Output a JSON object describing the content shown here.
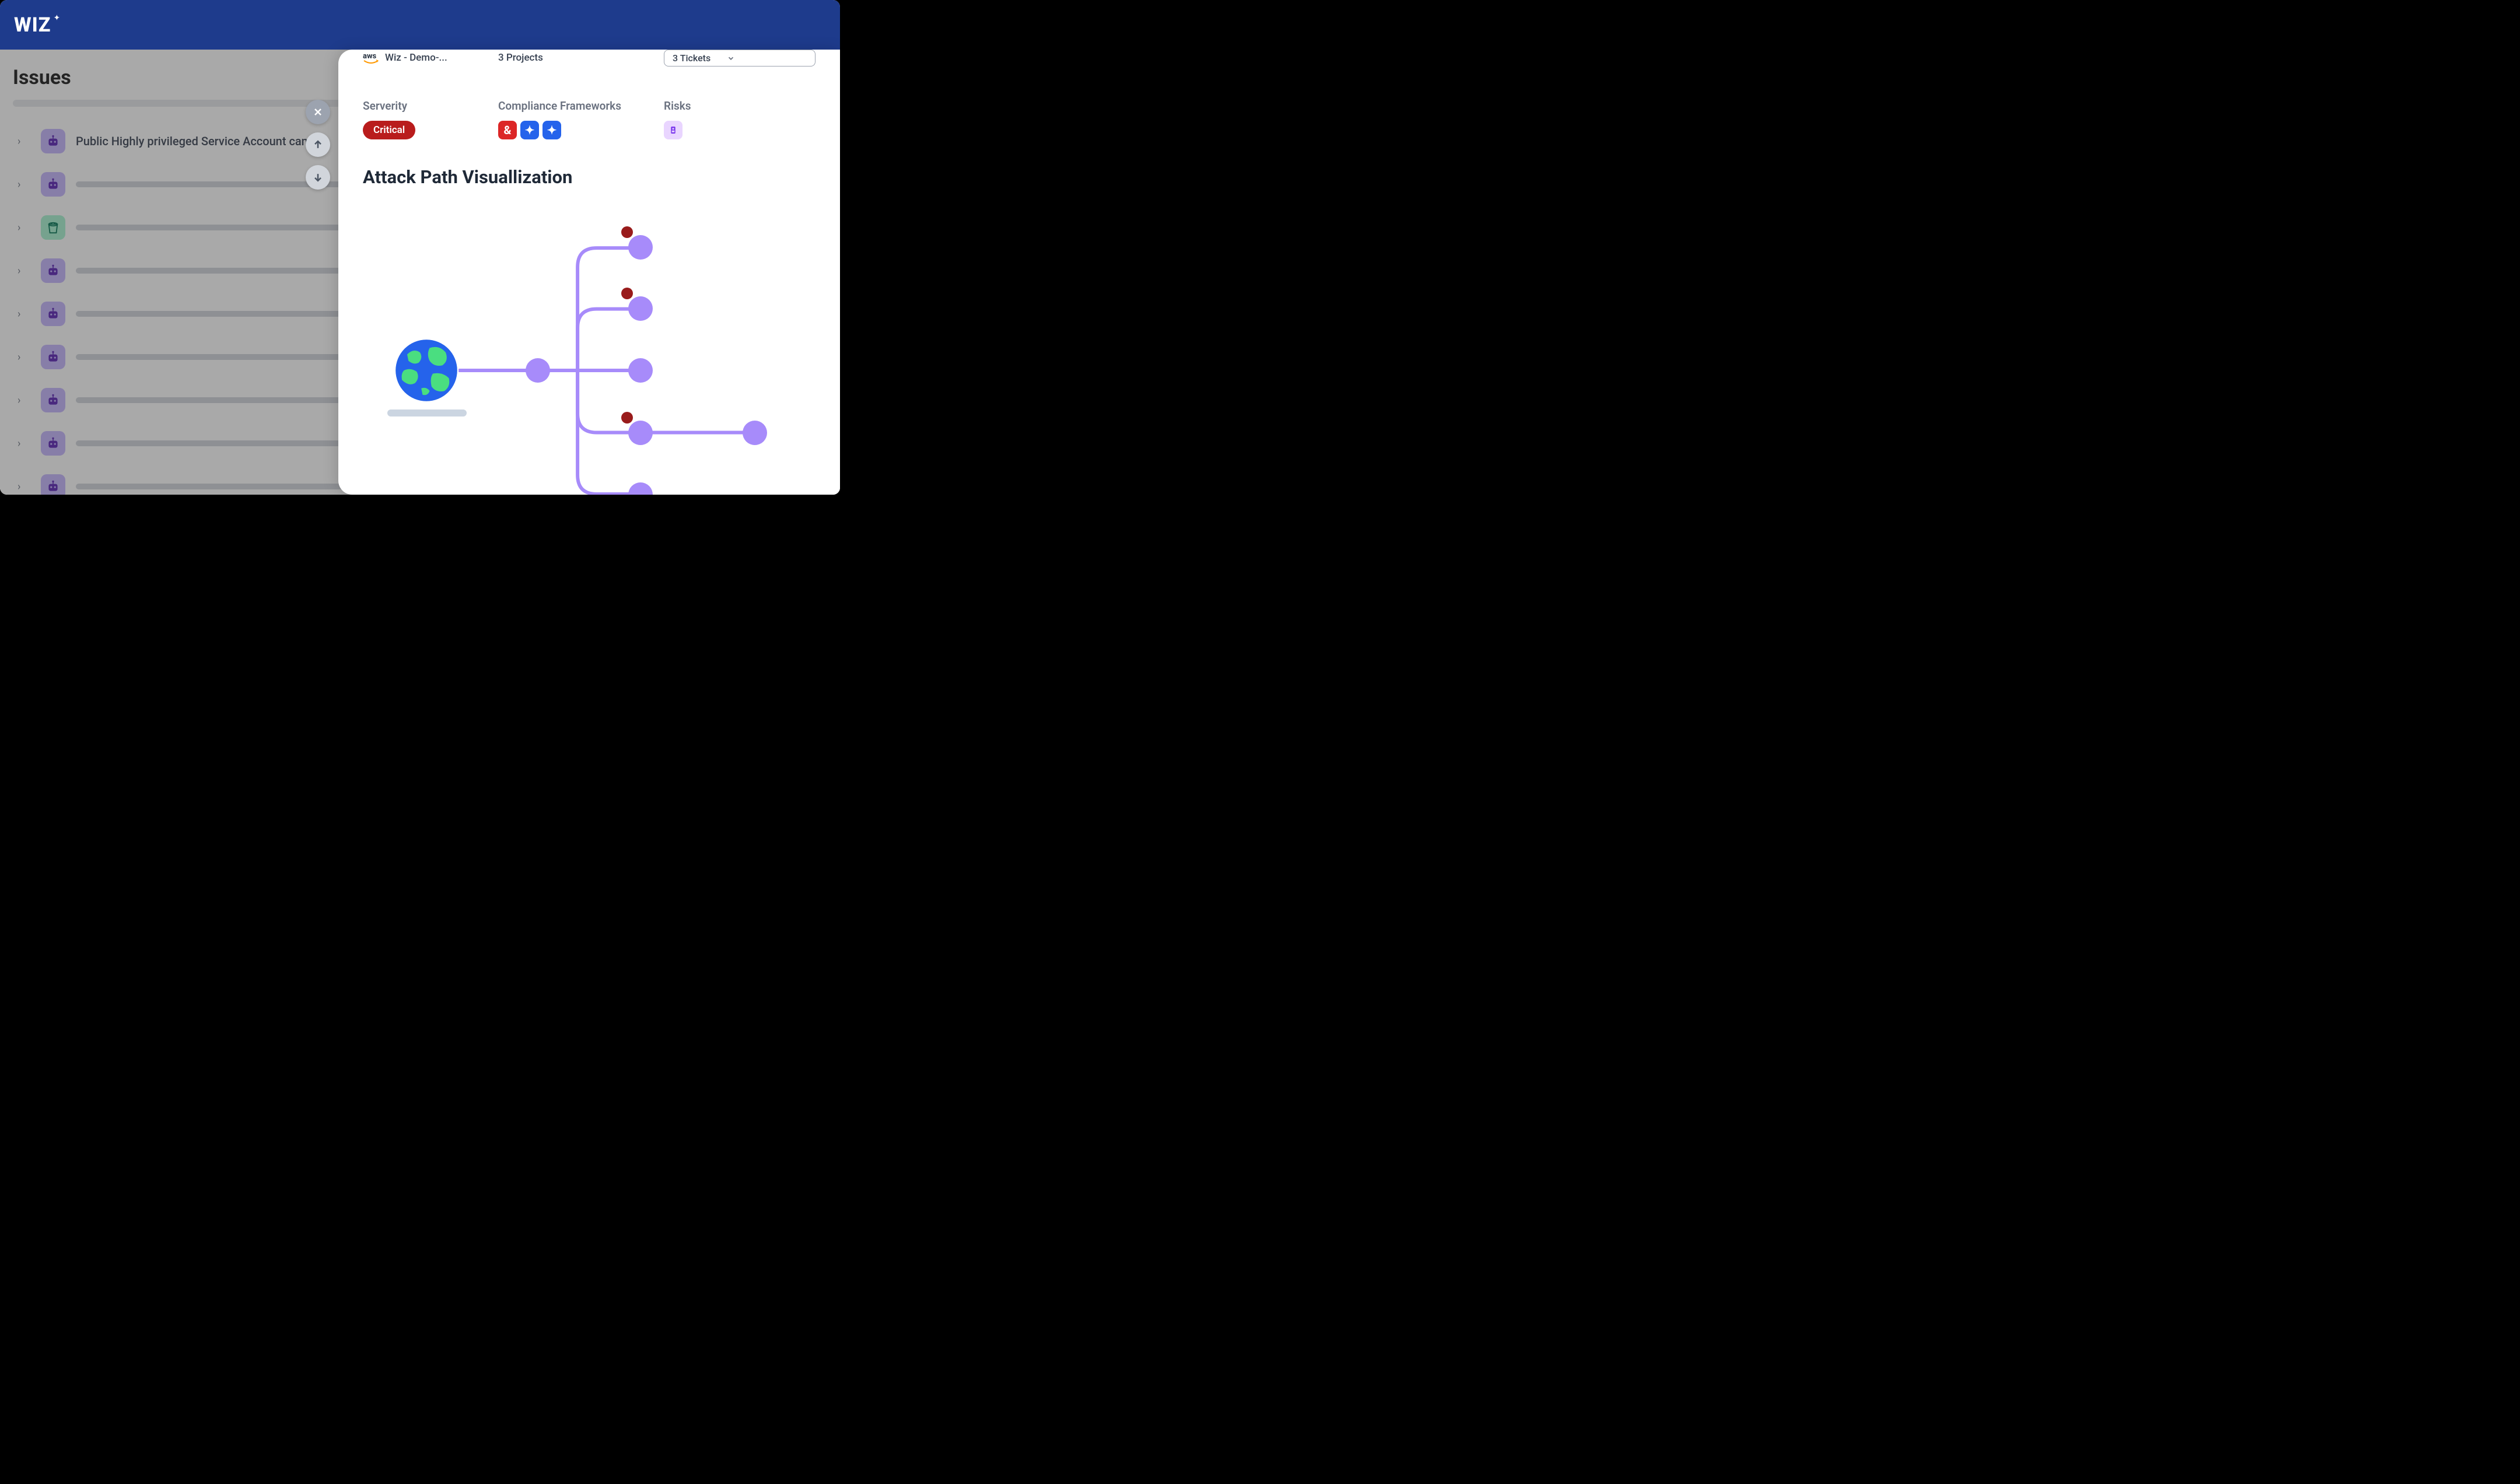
{
  "header": {
    "logo_text": "WIZ"
  },
  "issues": {
    "title": "Issues",
    "first_item_text": "Public Highly privileged Service Account can b",
    "items": [
      {
        "type": "robot"
      },
      {
        "type": "robot"
      },
      {
        "type": "bucket"
      },
      {
        "type": "robot"
      },
      {
        "type": "robot"
      },
      {
        "type": "robot"
      },
      {
        "type": "robot"
      },
      {
        "type": "robot"
      },
      {
        "type": "robot"
      }
    ]
  },
  "panel": {
    "cloud": {
      "provider": "aws",
      "name": "Wiz - Demo-..."
    },
    "projects": "3 Projects",
    "tickets": "3 Tickets",
    "severity_label": "Serverity",
    "severity_value": "Critical",
    "compliance_label": "Compliance Frameworks",
    "risks_label": "Risks",
    "viz_title": "Attack Path Visuallization"
  }
}
